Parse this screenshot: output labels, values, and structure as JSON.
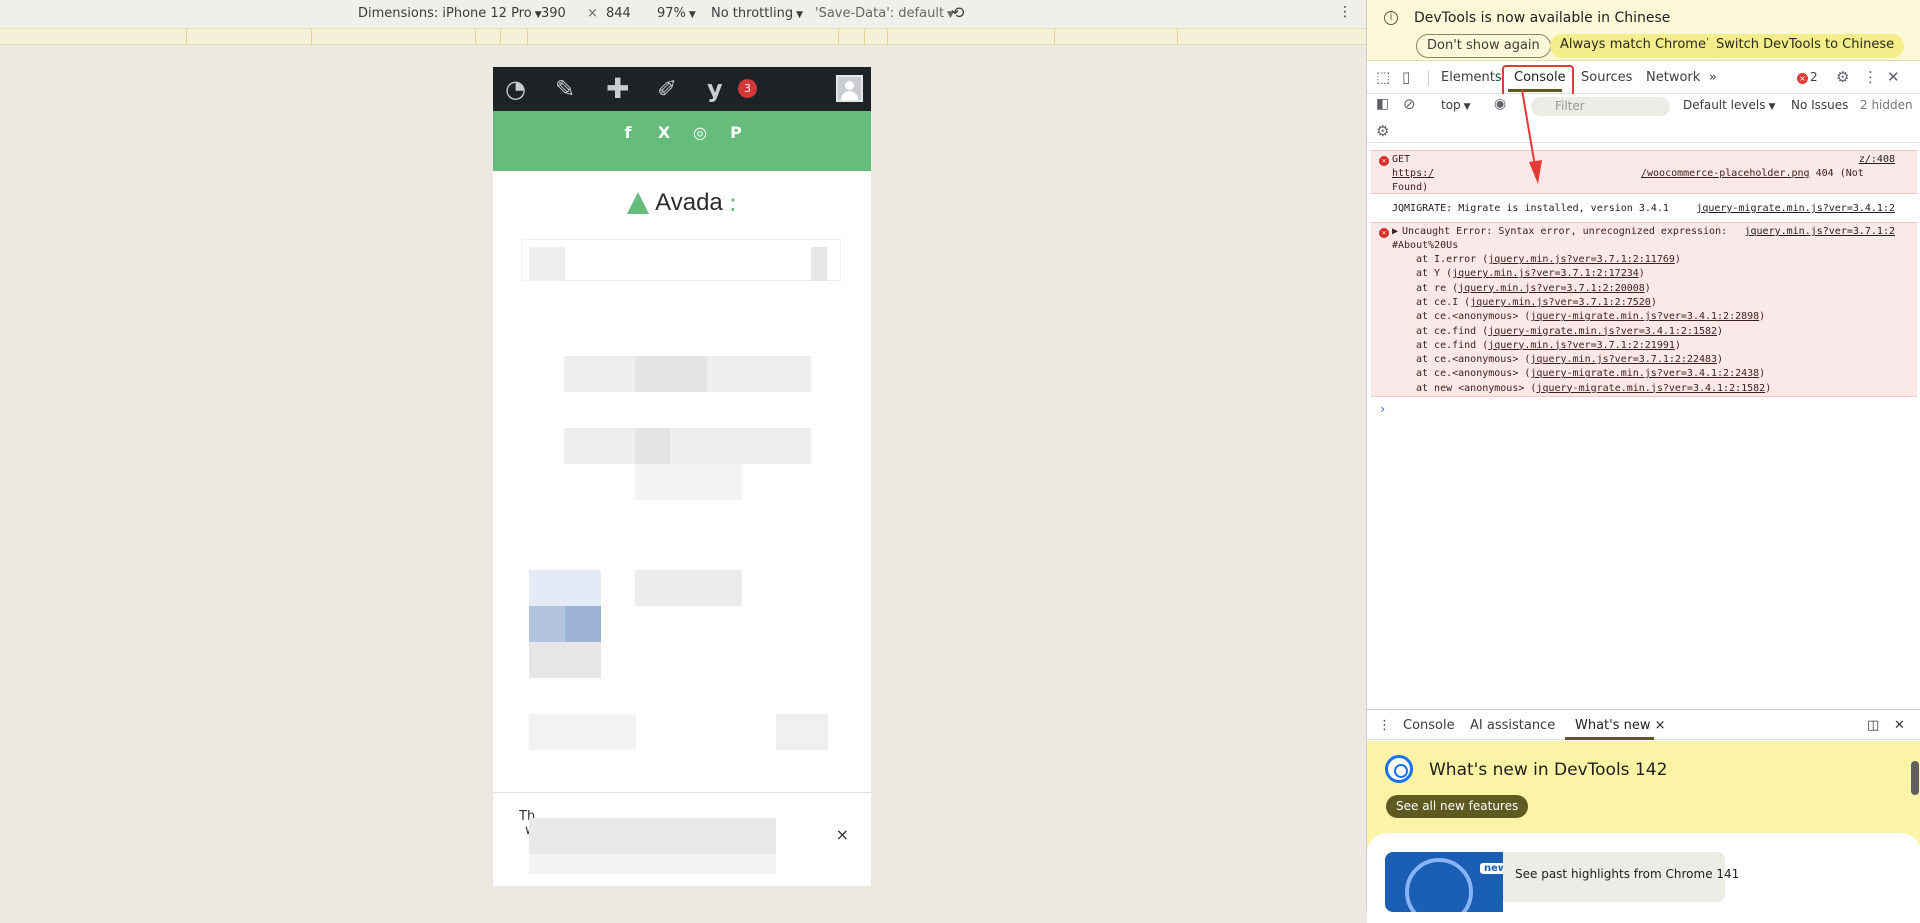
{
  "device_toolbar": {
    "dimensions_label": "Dimensions: iPhone 12 Pro",
    "width": "390",
    "times": "×",
    "height": "844",
    "zoom": "97%",
    "throttling": "No throttling",
    "save_data": "'Save-Data': default"
  },
  "phone": {
    "wp_badge": "3",
    "logo_text": "Avada",
    "logo_colon": ":",
    "social_icons": [
      "f",
      "X",
      "◎",
      "P"
    ],
    "cookie_text": "Th",
    "cookie_text2": "w",
    "cookie_close": "×"
  },
  "devtools": {
    "infobar": {
      "message": "DevTools is now available in Chinese",
      "dont_show": "Don't show again",
      "always_match": "Always match Chrome's language",
      "switch": "Switch DevTools to Chinese"
    },
    "tabs": [
      "Elements",
      "Console",
      "Sources",
      "Network"
    ],
    "more_tabs": "»",
    "error_count": "2",
    "filterbar": {
      "context": "top",
      "filter_placeholder": "Filter",
      "levels": "Default levels",
      "issues": "No Issues",
      "hidden": "2 hidden"
    },
    "console": {
      "msg1": {
        "line1": "GET",
        "line1_src": "z/:408",
        "line2_a": "https:/",
        "line2_link": "/woocommerce-placeholder.png",
        "line2_b": "404 (Not",
        "line3": "Found)"
      },
      "msg2": {
        "text": "JQMIGRATE: Migrate is installed, version 3.4.1",
        "src": "jquery-migrate.min.js?ver=3.4.1:2"
      },
      "msg3": {
        "line1": "Uncaught Error: Syntax error, unrecognized expression:",
        "src": "jquery.min.js?ver=3.7.1:2",
        "line2": "#About%20Us",
        "stack": [
          {
            "fn": "at I.error (",
            "link": "jquery.min.js?ver=3.7.1:2:11769",
            "end": ")"
          },
          {
            "fn": "at Y (",
            "link": "jquery.min.js?ver=3.7.1:2:17234",
            "end": ")"
          },
          {
            "fn": "at re (",
            "link": "jquery.min.js?ver=3.7.1:2:20008",
            "end": ")"
          },
          {
            "fn": "at ce.I (",
            "link": "jquery.min.js?ver=3.7.1:2:7520",
            "end": ")"
          },
          {
            "fn": "at ce.<anonymous> (",
            "link": "jquery-migrate.min.js?ver=3.4.1:2:2898",
            "end": ")"
          },
          {
            "fn": "at ce.find (",
            "link": "jquery-migrate.min.js?ver=3.4.1:2:1582",
            "end": ")"
          },
          {
            "fn": "at ce.find (",
            "link": "jquery.min.js?ver=3.7.1:2:21991",
            "end": ")"
          },
          {
            "fn": "at ce.<anonymous> (",
            "link": "jquery.min.js?ver=3.7.1:2:22483",
            "end": ")"
          },
          {
            "fn": "at ce.<anonymous> (",
            "link": "jquery-migrate.min.js?ver=3.4.1:2:2438",
            "end": ")"
          },
          {
            "fn": "at new <anonymous> (",
            "link": "jquery-migrate.min.js?ver=3.4.1:2:1582",
            "end": ")"
          }
        ]
      },
      "prompt": "›"
    },
    "drawer": {
      "tabs": [
        "Console",
        "AI assistance",
        "What's new"
      ],
      "close": "×",
      "whatsnew_title": "What's new in DevTools 142",
      "see_all": "See all new features",
      "new_badge": "new",
      "past_highlights": "See past highlights from Chrome 141"
    }
  }
}
